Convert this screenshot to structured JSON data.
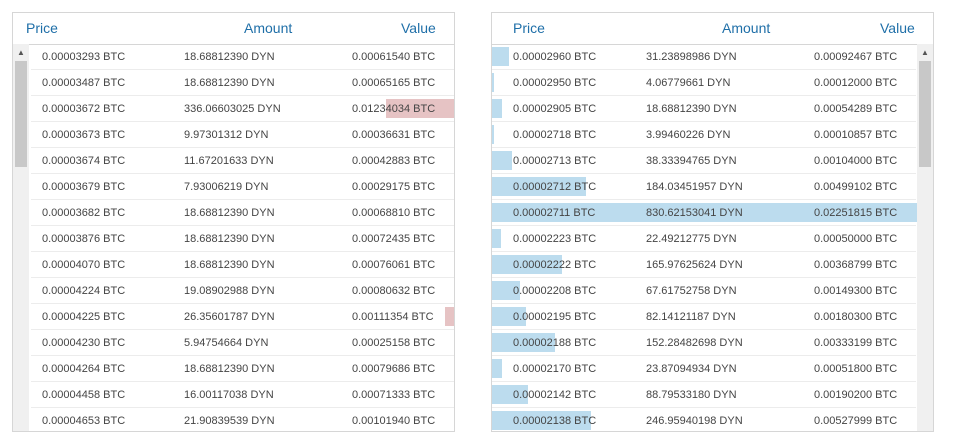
{
  "sell_book": {
    "headers": {
      "price": "Price",
      "amount": "Amount",
      "value": "Value"
    },
    "rows": [
      {
        "price": "0.00003293 BTC",
        "amount": "18.68812390 DYN",
        "value": "0.00061540 BTC",
        "depth": 0
      },
      {
        "price": "0.00003487 BTC",
        "amount": "18.68812390 DYN",
        "value": "0.00065165 BTC",
        "depth": 0
      },
      {
        "price": "0.00003672 BTC",
        "amount": "336.06603025 DYN",
        "value": "0.01234034 BTC",
        "depth": 0.161
      },
      {
        "price": "0.00003673 BTC",
        "amount": "9.97301312 DYN",
        "value": "0.00036631 BTC",
        "depth": 0
      },
      {
        "price": "0.00003674 BTC",
        "amount": "11.67201633 DYN",
        "value": "0.00042883 BTC",
        "depth": 0
      },
      {
        "price": "0.00003679 BTC",
        "amount": "7.93006219 DYN",
        "value": "0.00029175 BTC",
        "depth": 0
      },
      {
        "price": "0.00003682 BTC",
        "amount": "18.68812390 DYN",
        "value": "0.00068810 BTC",
        "depth": 0
      },
      {
        "price": "0.00003876 BTC",
        "amount": "18.68812390 DYN",
        "value": "0.00072435 BTC",
        "depth": 0
      },
      {
        "price": "0.00004070 BTC",
        "amount": "18.68812390 DYN",
        "value": "0.00076061 BTC",
        "depth": 0
      },
      {
        "price": "0.00004224 BTC",
        "amount": "19.08902988 DYN",
        "value": "0.00080632 BTC",
        "depth": 0
      },
      {
        "price": "0.00004225 BTC",
        "amount": "26.35601787 DYN",
        "value": "0.00111354 BTC",
        "depth": 0.021
      },
      {
        "price": "0.00004230 BTC",
        "amount": "5.94754664 DYN",
        "value": "0.00025158 BTC",
        "depth": 0
      },
      {
        "price": "0.00004264 BTC",
        "amount": "18.68812390 DYN",
        "value": "0.00079686 BTC",
        "depth": 0
      },
      {
        "price": "0.00004458 BTC",
        "amount": "16.00117038 DYN",
        "value": "0.00071333 BTC",
        "depth": 0
      },
      {
        "price": "0.00004653 BTC",
        "amount": "21.90839539 DYN",
        "value": "0.00101940 BTC",
        "depth": 0
      }
    ]
  },
  "buy_book": {
    "headers": {
      "price": "Price",
      "amount": "Amount",
      "value": "Value"
    },
    "rows": [
      {
        "price": "0.00002960 BTC",
        "amount": "31.23898986 DYN",
        "value": "0.00092467 BTC",
        "depth": 0.041
      },
      {
        "price": "0.00002950 BTC",
        "amount": "4.06779661 DYN",
        "value": "0.00012000 BTC",
        "depth": 0.005
      },
      {
        "price": "0.00002905 BTC",
        "amount": "18.68812390 DYN",
        "value": "0.00054289 BTC",
        "depth": 0.024
      },
      {
        "price": "0.00002718 BTC",
        "amount": "3.99460226 DYN",
        "value": "0.00010857 BTC",
        "depth": 0.005
      },
      {
        "price": "0.00002713 BTC",
        "amount": "38.33394765 DYN",
        "value": "0.00104000 BTC",
        "depth": 0.047
      },
      {
        "price": "0.00002712 BTC",
        "amount": "184.03451957 DYN",
        "value": "0.00499102 BTC",
        "depth": 0.222
      },
      {
        "price": "0.00002711 BTC",
        "amount": "830.62153041 DYN",
        "value": "0.02251815 BTC",
        "depth": 1
      },
      {
        "price": "0.00002223 BTC",
        "amount": "22.49212775 DYN",
        "value": "0.00050000 BTC",
        "depth": 0.022
      },
      {
        "price": "0.00002222 BTC",
        "amount": "165.97625624 DYN",
        "value": "0.00368799 BTC",
        "depth": 0.164
      },
      {
        "price": "0.00002208 BTC",
        "amount": "67.61752758 DYN",
        "value": "0.00149300 BTC",
        "depth": 0.066
      },
      {
        "price": "0.00002195 BTC",
        "amount": "82.14121187 DYN",
        "value": "0.00180300 BTC",
        "depth": 0.08
      },
      {
        "price": "0.00002188 BTC",
        "amount": "152.28482698 DYN",
        "value": "0.00333199 BTC",
        "depth": 0.148
      },
      {
        "price": "0.00002170 BTC",
        "amount": "23.87094934 DYN",
        "value": "0.00051800 BTC",
        "depth": 0.023
      },
      {
        "price": "0.00002142 BTC",
        "amount": "88.79533180 DYN",
        "value": "0.00190200 BTC",
        "depth": 0.085
      },
      {
        "price": "0.00002138 BTC",
        "amount": "246.95940198 DYN",
        "value": "0.00527999 BTC",
        "depth": 0.234
      }
    ]
  },
  "colors": {
    "header_text": "#1f6fa8",
    "sell_depth_fill": "#e6c3c4",
    "buy_depth_fill": "#bcdcee",
    "border": "#d6d6d6"
  },
  "icons": {
    "scroll_up": "chevron-up-icon"
  }
}
